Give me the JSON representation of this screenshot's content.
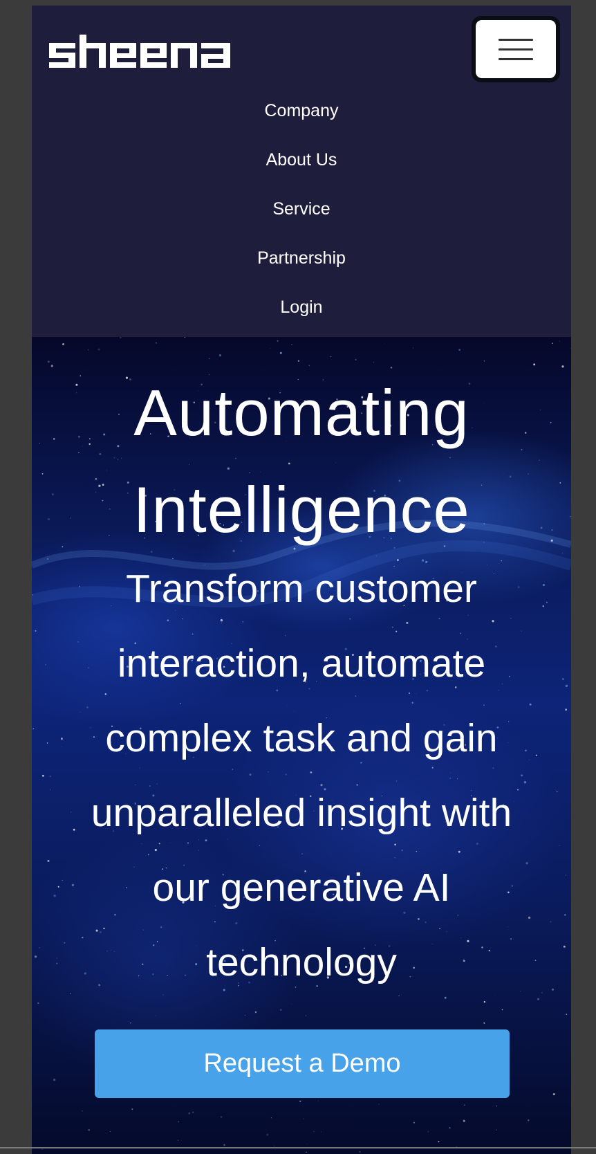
{
  "header": {
    "logo_text": "sheena",
    "menu_toggle_icon": "hamburger-menu-icon"
  },
  "nav": {
    "items": [
      {
        "label": "Company"
      },
      {
        "label": "About Us"
      },
      {
        "label": "Service"
      },
      {
        "label": "Partnership"
      },
      {
        "label": "Login"
      }
    ]
  },
  "hero": {
    "title_line1": "Automating",
    "title_line2": "Intelligence",
    "subtitle": "Transform customer interaction, automate complex task and gain unparalleled insight with our generative AI technology",
    "cta_label": "Request a Demo"
  },
  "colors": {
    "header_bg": "#1e1e3c",
    "cta_bg": "#48a2ea",
    "text": "#ffffff"
  }
}
